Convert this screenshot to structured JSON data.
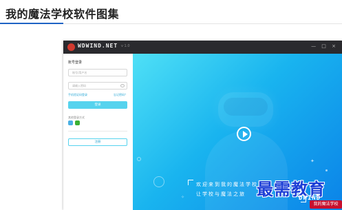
{
  "page": {
    "title": "我的魔法学校软件图集"
  },
  "app": {
    "brand": "WDWIND.NET",
    "version": "v 1.0",
    "window_controls": "— □ ×"
  },
  "login": {
    "heading": "账号登录",
    "account_placeholder": "账号/用户名",
    "password_placeholder": "请输入密码",
    "forgot_link": "手机验证码登录",
    "register_link": "忘记密码？",
    "login_button": "登录",
    "other_login_label": "其他登录方式",
    "register_button": "注册"
  },
  "hero": {
    "tagline_line1": "欢迎来到我的魔法学校",
    "tagline_line2": "让学校与魔法之旅"
  },
  "watermark": {
    "text": "最需教育",
    "ghost_text": "DWIND",
    "badge": "我的魔法学校"
  },
  "colors": {
    "accent": "#1e63c4",
    "hero_start": "#4fe0f6",
    "hero_end": "#0b83e8",
    "login_button": "#56d3ee"
  }
}
